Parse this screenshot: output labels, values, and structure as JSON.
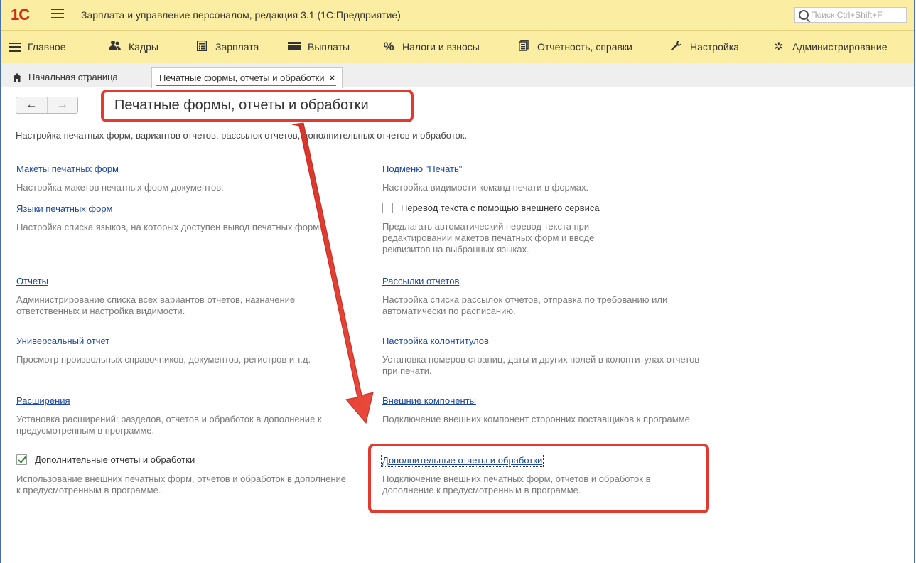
{
  "app": {
    "logo_text": "1С",
    "title": "Зарплата и управление персоналом, редакция 3.1  (1С:Предприятие)",
    "search_placeholder": "Поиск Ctrl+Shift+F"
  },
  "sections": [
    {
      "label": "Главное",
      "icon": "menu-icon"
    },
    {
      "label": "Кадры",
      "icon": "people-icon"
    },
    {
      "label": "Зарплата",
      "icon": "calculator-icon"
    },
    {
      "label": "Выплаты",
      "icon": "wallet-icon"
    },
    {
      "label": "Налоги и взносы",
      "icon": "percent-icon"
    },
    {
      "label": "Отчетность, справки",
      "icon": "reports-icon"
    },
    {
      "label": "Настройка",
      "icon": "wrench-icon"
    },
    {
      "label": "Администрирование",
      "icon": "gear-icon"
    }
  ],
  "tabs": {
    "home": "Начальная страница",
    "active": "Печатные формы, отчеты и обработки",
    "close_glyph": "×"
  },
  "nav": {
    "back": "←",
    "forward": "→"
  },
  "page": {
    "title": "Печатные формы, отчеты и обработки",
    "description": "Настройка печатных форм, вариантов отчетов, рассылок отчетов, дополнительных отчетов и обработок."
  },
  "left": {
    "layouts_link": "Макеты печатных форм",
    "layouts_desc": "Настройка макетов печатных форм документов.",
    "languages_link": "Языки печатных форм",
    "languages_desc": "Настройка списка языков, на которых доступен вывод печатных форм.",
    "reports_link": "Отчеты",
    "reports_desc": "Администрирование списка всех вариантов отчетов, назначение ответственных и настройка видимости.",
    "universal_link": "Универсальный отчет",
    "universal_desc": "Просмотр произвольных справочников, документов, регистров и т.д.",
    "extensions_link": "Расширения",
    "extensions_desc": "Установка расширений: разделов, отчетов и обработок в дополнение к предусмотренным в программе.",
    "additional_checkbox": "Дополнительные отчеты и обработки",
    "additional_checked": true,
    "additional_desc": "Использование внешних печатных форм, отчетов и обработок в дополнение к предусмотренным в программе."
  },
  "right": {
    "print_submenu_link": "Подменю \"Печать\"",
    "print_submenu_desc": "Настройка видимости команд печати в формах.",
    "translation_checkbox": "Перевод текста с помощью внешнего сервиса",
    "translation_checked": false,
    "translation_desc": "Предлагать автоматический перевод текста при редактировании макетов печатных форм и вводе реквизитов на выбранных языках.",
    "mailing_link": "Рассылки отчетов",
    "mailing_desc": "Настройка списка рассылок отчетов, отправка по требованию или автоматически по расписанию.",
    "headers_link": "Настройка колонтитулов",
    "headers_desc": "Установка номеров страниц, даты и других полей в колонтитулах отчетов при печати.",
    "components_link": "Внешние компоненты",
    "components_desc": "Подключение внешних компонент сторонних поставщиков к программе.",
    "additional_link": "Дополнительные отчеты и обработки",
    "additional_desc": "Подключение внешних печатных форм, отчетов и обработок в дополнение к предусмотренным в программе."
  },
  "annotation": {
    "color": "#e23a2f"
  }
}
